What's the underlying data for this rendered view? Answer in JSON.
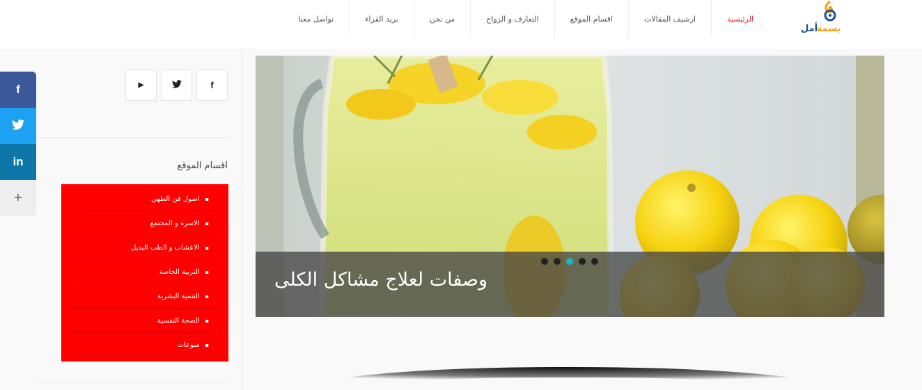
{
  "site": {
    "logo_text": "بسمة أمل"
  },
  "nav": {
    "items": [
      {
        "label": "الرئيسية",
        "active": true
      },
      {
        "label": "ارشيف المقالات",
        "active": false
      },
      {
        "label": "اقسام الموقع",
        "active": false
      },
      {
        "label": "التعارف و الزواج",
        "active": false
      },
      {
        "label": "من نحن",
        "active": false
      },
      {
        "label": "بريد القراء",
        "active": false
      },
      {
        "label": "تواصل معنا",
        "active": false
      }
    ]
  },
  "share_bar": {
    "facebook": "f",
    "twitter": "t",
    "linkedin": "in",
    "more": "+"
  },
  "sidebar": {
    "social": {
      "youtube": "▶",
      "twitter": "t",
      "facebook": "f"
    },
    "widget_title": "اقسام الموقع",
    "categories": [
      "اصول فن الطهي",
      "الاسره و المجتمع",
      "الاعشاب و الطب البديل",
      "التربية الخاصة",
      "التنمية البشرية",
      "الصحة النفسية",
      "منوعات"
    ]
  },
  "slider": {
    "caption": "وصفات لعلاج مشاكل الكلى",
    "slide_count": 5,
    "active_index": 2
  },
  "colors": {
    "accent_red": "#ff0000",
    "nav_active": "#e0282d",
    "dot_active": "#1fb3c4",
    "facebook": "#3b5998",
    "twitter": "#1da1f2",
    "linkedin": "#0e76a8"
  }
}
